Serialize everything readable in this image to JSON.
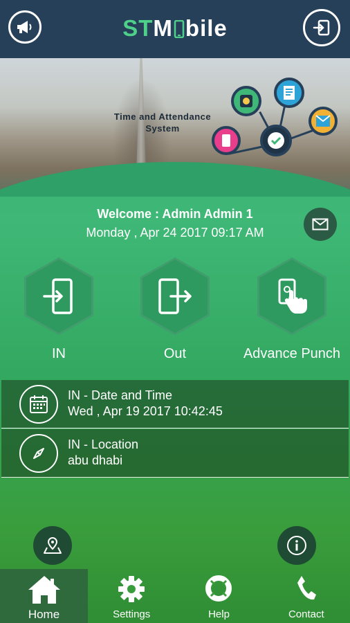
{
  "header": {
    "brand_prefix": "ST",
    "brand_suffix": "Mbile",
    "announcement_icon": "megaphone-icon",
    "logout_icon": "sign-out-icon"
  },
  "banner": {
    "line1": "Time and Attendance",
    "line2": "System"
  },
  "welcome": {
    "text": "Welcome : Admin Admin 1",
    "datetime": "Monday , Apr 24 2017  09:17 AM"
  },
  "actions": [
    {
      "label": "IN",
      "icon": "sign-in-icon"
    },
    {
      "label": "Out",
      "icon": "sign-out-icon"
    },
    {
      "label": "Advance Punch",
      "icon": "touch-punch-icon"
    }
  ],
  "info": {
    "date_title": "IN -  Date and Time",
    "date_value": "Wed , Apr 19 2017 10:42:45",
    "location_title": "IN -   Location",
    "location_value": "abu dhabi"
  },
  "nav": [
    {
      "label": "Home",
      "icon": "home-icon",
      "active": true
    },
    {
      "label": "Settings",
      "icon": "gear-icon"
    },
    {
      "label": "Help",
      "icon": "lifebuoy-icon"
    },
    {
      "label": "Contact",
      "icon": "phone-icon"
    }
  ],
  "colors": {
    "header": "#26405a",
    "accent": "#4fd08a",
    "background": "#3fb877"
  }
}
